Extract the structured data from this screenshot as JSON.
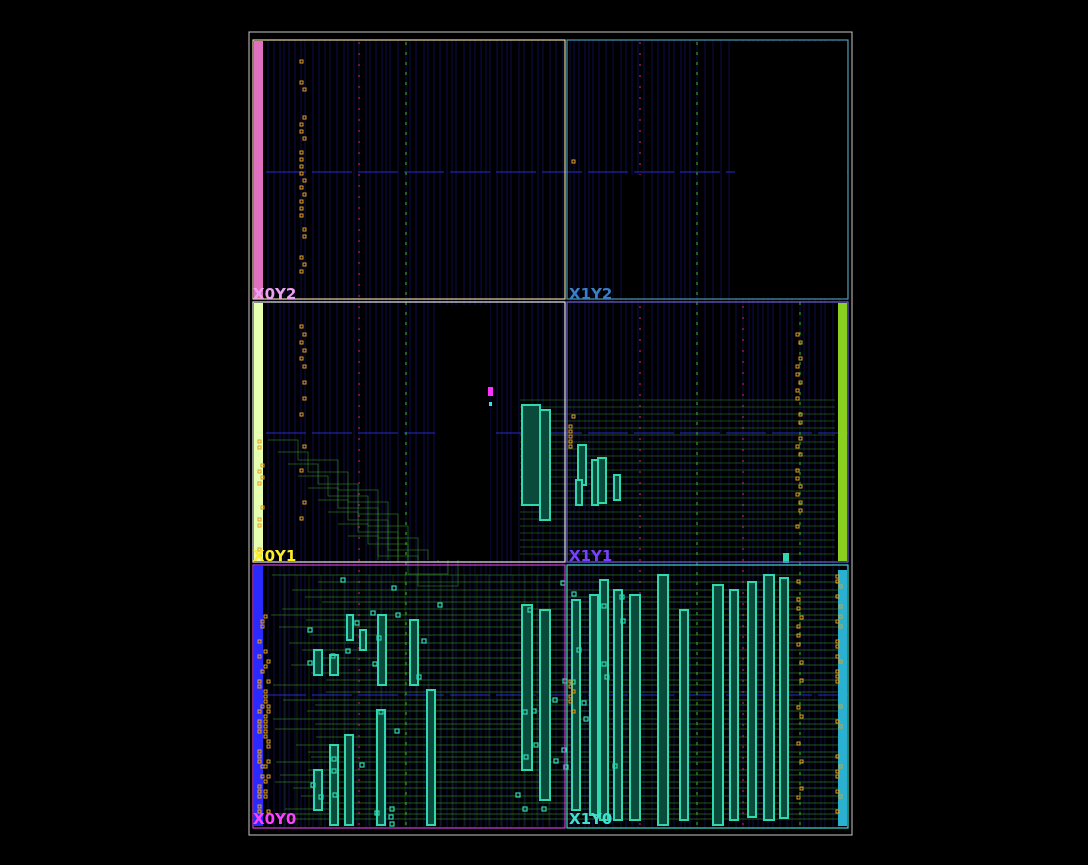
{
  "view": {
    "background": "#000000",
    "device_border_color": "#c8c8c8"
  },
  "clock_regions": [
    {
      "id": "X0Y2",
      "label": "X0Y2",
      "label_color": "#f0a0f0",
      "border_color": "#e6d6a0",
      "column": 0,
      "row": 0
    },
    {
      "id": "X1Y2",
      "label": "X1Y2",
      "label_color": "#3b7fc4",
      "border_color": "#4a9ab0",
      "column": 1,
      "row": 0
    },
    {
      "id": "X0Y1",
      "label": "X0Y1",
      "label_color": "#ffee22",
      "border_color": "#e8e8e8",
      "column": 0,
      "row": 1
    },
    {
      "id": "X1Y1",
      "label": "X1Y1",
      "label_color": "#7a40ff",
      "border_color": "#7060d0",
      "column": 1,
      "row": 1
    },
    {
      "id": "X0Y0",
      "label": "X0Y0",
      "label_color": "#ff40ff",
      "border_color": "#d040d0",
      "column": 0,
      "row": 0.5
    },
    {
      "id": "X1Y0",
      "label": "X1Y0",
      "label_color": "#40e0d0",
      "border_color": "#40d8c8",
      "column": 1,
      "row": 0.5
    }
  ],
  "colors": {
    "column_lines": "#1a1aa0",
    "dsp_column": "#c02060",
    "bram_column": "#2a8a2a",
    "io_bank_left_top": "#e070c0",
    "io_bank_left_mid": "#e6ffb0",
    "io_bank_left_bottom": "#2a2aff",
    "io_bank_right_mid": "#8ad020",
    "routing": "#3a9a2a",
    "cells": "#30d8b0",
    "io_pins": "#e0a020",
    "marker_magenta": "#ff30ff",
    "marker_cyan": "#30e0ff"
  }
}
